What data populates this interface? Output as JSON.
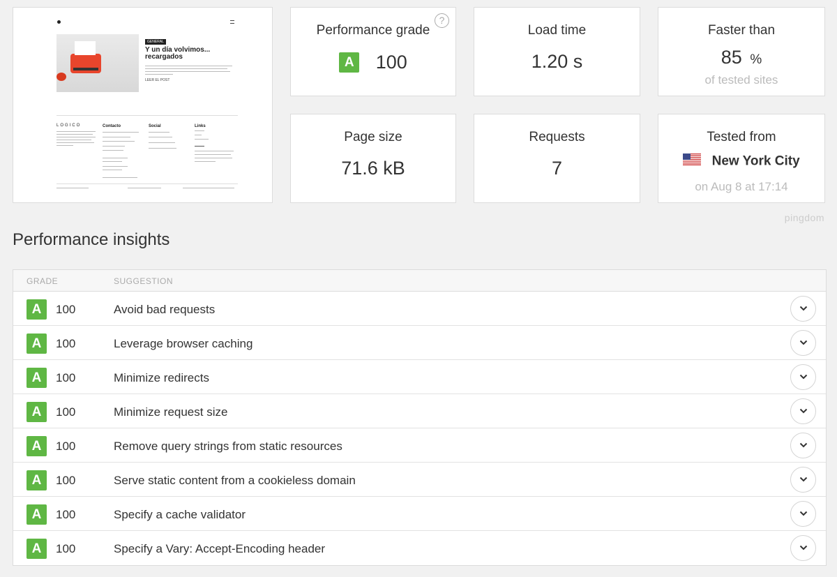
{
  "metrics": {
    "performance_grade": {
      "title": "Performance grade",
      "grade": "A",
      "score": "100"
    },
    "load_time": {
      "title": "Load time",
      "value": "1.20 s"
    },
    "faster_than": {
      "title": "Faster than",
      "value": "85",
      "unit": "%",
      "sub": "of tested sites"
    },
    "page_size": {
      "title": "Page size",
      "value": "71.6 kB"
    },
    "requests": {
      "title": "Requests",
      "value": "7"
    },
    "tested_from": {
      "title": "Tested from",
      "location": "New York City",
      "when": "on Aug 8 at 17:14"
    }
  },
  "brand": "pingdom",
  "thumbnail": {
    "tag": "GENERAL",
    "headline": "Y un día volvimos... recargados",
    "read_more": "LEER EL POST",
    "logo": "LOGICO",
    "col_contact": "Contacto",
    "col_social": "Social",
    "col_links": "Links"
  },
  "insights": {
    "title": "Performance insights",
    "col_grade": "GRADE",
    "col_suggestion": "SUGGESTION",
    "rows": [
      {
        "grade": "A",
        "score": "100",
        "suggestion": "Avoid bad requests"
      },
      {
        "grade": "A",
        "score": "100",
        "suggestion": "Leverage browser caching"
      },
      {
        "grade": "A",
        "score": "100",
        "suggestion": "Minimize redirects"
      },
      {
        "grade": "A",
        "score": "100",
        "suggestion": "Minimize request size"
      },
      {
        "grade": "A",
        "score": "100",
        "suggestion": "Remove query strings from static resources"
      },
      {
        "grade": "A",
        "score": "100",
        "suggestion": "Serve static content from a cookieless domain"
      },
      {
        "grade": "A",
        "score": "100",
        "suggestion": "Specify a cache validator"
      },
      {
        "grade": "A",
        "score": "100",
        "suggestion": "Specify a Vary: Accept-Encoding header"
      }
    ]
  },
  "colors": {
    "grade_green": "#5fb744",
    "border": "#dcdcdc",
    "muted": "#bbbbbb"
  },
  "icons": {
    "help": "question-circle-icon",
    "expand": "chevron-down-icon",
    "flag": "us-flag-icon"
  }
}
